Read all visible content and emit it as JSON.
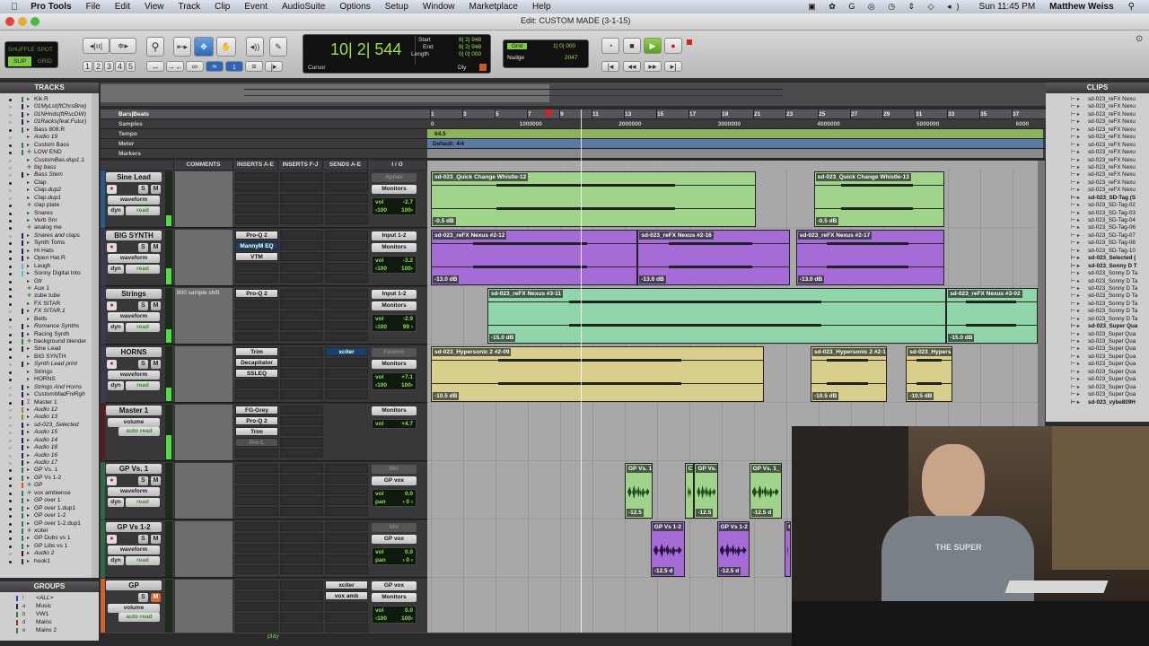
{
  "menubar": {
    "app": "Pro Tools",
    "items": [
      "File",
      "Edit",
      "View",
      "Track",
      "Clip",
      "Event",
      "AudioSuite",
      "Options",
      "Setup",
      "Window",
      "Marketplace",
      "Help"
    ],
    "clock": "Sun 11:45 PM",
    "user": "Matthew Weiss"
  },
  "window": {
    "title": "Edit: CUSTOM MADE (3-1-15)"
  },
  "toolbar": {
    "modes": [
      "SHUFFLE",
      "SPOT",
      "SLIP",
      "GRID"
    ],
    "active_mode": "SLIP",
    "zoom_presets": [
      "1",
      "2",
      "3",
      "4",
      "5"
    ],
    "counter": {
      "main": "10| 2| 544",
      "start_label": "Start",
      "end_label": "End",
      "length_label": "Length",
      "start": "8| 2| 948",
      "end": "8| 2| 948",
      "length": "0| 0| 000",
      "cursor_label": "Cursor",
      "dly_label": "Dly"
    },
    "grid": {
      "label": "Grid",
      "value": "1| 0| 000",
      "nudge_label": "Nudge",
      "nudge_value": "2047"
    }
  },
  "tracks_panel": {
    "title": "TRACKS",
    "items": [
      {
        "name": "Kik.R",
        "active": true,
        "color": "#2e7d4f"
      },
      {
        "name": "01MyLst(ftChrsBrw)",
        "active": false,
        "italic": true,
        "color": "#1c2a4a"
      },
      {
        "name": "01NHnds(ftRscDW)",
        "active": false,
        "italic": true,
        "color": "#1c2a4a"
      },
      {
        "name": "01Racks(feat.Futur)",
        "active": false,
        "italic": true,
        "color": "#1c2a4a"
      },
      {
        "name": "Bass 808.R",
        "active": true,
        "color": "#2e7d4f"
      },
      {
        "name": "Audio 19",
        "active": false,
        "italic": true,
        "color": ""
      },
      {
        "name": "Custom Bass",
        "active": true,
        "color": "#2e7d4f"
      },
      {
        "name": "LOW END",
        "active": true,
        "color": "#2e7d4f",
        "aux": true
      },
      {
        "name": "CustomBas.dup1.1",
        "active": false,
        "italic": true,
        "color": ""
      },
      {
        "name": "big bass",
        "active": false,
        "italic": true,
        "color": "",
        "aux": true
      },
      {
        "name": "Bass Stem",
        "active": false,
        "italic": true,
        "color": "#3a1418"
      },
      {
        "name": "Clap",
        "active": true,
        "color": ""
      },
      {
        "name": "Clap.dup2",
        "active": false,
        "italic": true,
        "color": ""
      },
      {
        "name": "Clap.dup1",
        "active": false,
        "italic": true,
        "color": ""
      },
      {
        "name": "clap plate",
        "active": true,
        "color": "",
        "aux": true
      },
      {
        "name": "Snares",
        "active": true,
        "color": ""
      },
      {
        "name": "Verb Snr",
        "active": true,
        "color": ""
      },
      {
        "name": "analog me",
        "active": true,
        "color": "",
        "aux": true
      },
      {
        "name": "Snares and claps",
        "active": false,
        "italic": true,
        "color": "#1c2a4a"
      },
      {
        "name": "Synth Toms",
        "active": true,
        "color": "#1c2a4a"
      },
      {
        "name": "Hi Hats",
        "active": true,
        "color": "#1c2a4a"
      },
      {
        "name": "Open Hat.R",
        "active": true,
        "color": "#1c2a4a"
      },
      {
        "name": "Laugh",
        "active": true,
        "color": "#5ab8e0"
      },
      {
        "name": "Sonny Digital Into",
        "active": true,
        "color": "#5ab8e0"
      },
      {
        "name": "Gtr",
        "active": true,
        "color": ""
      },
      {
        "name": "Aux 1",
        "active": true,
        "color": "",
        "aux": true
      },
      {
        "name": "zube tube",
        "active": true,
        "color": "",
        "aux": true
      },
      {
        "name": "FX SITAR",
        "active": true,
        "color": ""
      },
      {
        "name": "FX SITAR.1",
        "active": false,
        "italic": true,
        "color": "#1c2a4a"
      },
      {
        "name": "Bells",
        "active": true,
        "color": ""
      },
      {
        "name": "Romance Synths",
        "active": false,
        "italic": true,
        "color": "#1c2a4a"
      },
      {
        "name": "Racing Synth",
        "active": true,
        "color": "#1c2a4a"
      },
      {
        "name": "background blender",
        "active": true,
        "color": "#2e7d4f",
        "aux": true
      },
      {
        "name": "Sine Lead",
        "active": true,
        "color": "#1c2a4a"
      },
      {
        "name": "BIG SYNTH",
        "active": true,
        "color": ""
      },
      {
        "name": "Synth Lead print",
        "active": false,
        "italic": true,
        "color": "#1c2a4a"
      },
      {
        "name": "Strings",
        "active": true,
        "color": ""
      },
      {
        "name": "HORNS",
        "active": true,
        "color": ""
      },
      {
        "name": "Strings And Horns",
        "active": false,
        "italic": true,
        "color": "#1c2a4a"
      },
      {
        "name": "CustomMadFnlRgh",
        "active": false,
        "italic": true,
        "color": "#1c2a4a"
      },
      {
        "name": "Master 1",
        "active": true,
        "color": "#3a1418",
        "master": true
      },
      {
        "name": "Audio 12",
        "active": false,
        "italic": true,
        "color": "#8a8a2a"
      },
      {
        "name": "Audio 13",
        "active": false,
        "italic": true,
        "color": "#8a8a2a"
      },
      {
        "name": "sd-023_Selected",
        "active": false,
        "italic": true,
        "color": "#1c2a4a"
      },
      {
        "name": "Audio 15",
        "active": false,
        "italic": true,
        "color": "#1c2a4a"
      },
      {
        "name": "Audio 14",
        "active": false,
        "italic": true,
        "color": "#1c2a4a"
      },
      {
        "name": "Audio 18",
        "active": false,
        "italic": true,
        "color": "#1c2a4a"
      },
      {
        "name": "Audio 16",
        "active": false,
        "italic": true,
        "color": "#1c2a4a"
      },
      {
        "name": "Audio 17",
        "active": false,
        "italic": true,
        "color": "#1c2a4a"
      },
      {
        "name": "GP Vs. 1",
        "active": true,
        "color": "#2e7d4f"
      },
      {
        "name": "GP Vs 1-2",
        "active": true,
        "color": "#2e7d4f"
      },
      {
        "name": "GP",
        "active": true,
        "color": "#d0522a",
        "aux": true
      },
      {
        "name": "vox ambience",
        "active": true,
        "color": "#2e7d4f",
        "aux": true
      },
      {
        "name": "GP over 1",
        "active": true,
        "color": "#2e7d4f"
      },
      {
        "name": "GP over 1.dup1",
        "active": true,
        "color": "#2e7d4f"
      },
      {
        "name": "GP over 1-2",
        "active": true,
        "color": "#2e7d4f"
      },
      {
        "name": "GP over 1-2.dup1",
        "active": true,
        "color": "#2e7d4f"
      },
      {
        "name": "xciter",
        "active": true,
        "color": "#2e7d4f",
        "aux": true
      },
      {
        "name": "GP Dubs vs 1",
        "active": true,
        "color": "#2e7d4f"
      },
      {
        "name": "GP Libs vs 1",
        "active": true,
        "color": "#2e7d4f"
      },
      {
        "name": "Audio 2",
        "active": false,
        "italic": true,
        "color": "#3a1418"
      },
      {
        "name": "hook1",
        "active": true,
        "color": "#1c2a4a"
      }
    ]
  },
  "groups_panel": {
    "title": "GROUPS",
    "items": [
      {
        "id": "!",
        "name": "<ALL>",
        "color": "#2244cc"
      },
      {
        "id": "a",
        "name": "Music",
        "color": "#1c2a4a"
      },
      {
        "id": "b",
        "name": "VW1",
        "color": "#2e7d4f"
      },
      {
        "id": "d",
        "name": "Mains",
        "color": "#a02828"
      },
      {
        "id": "e",
        "name": "Mains 2",
        "color": "#2e7d4f"
      }
    ]
  },
  "clips_panel": {
    "title": "CLIPS",
    "items": [
      {
        "name": "sd-023_reFX Nexu"
      },
      {
        "name": "sd-023_reFX Nexu"
      },
      {
        "name": "sd-023_reFX Nexu"
      },
      {
        "name": "sd-023_reFX Nexu"
      },
      {
        "name": "sd-023_reFX Nexu"
      },
      {
        "name": "sd-023_reFX Nexu"
      },
      {
        "name": "sd-023_reFX Nexu"
      },
      {
        "name": "sd-023_reFX Nexu"
      },
      {
        "name": "sd-023_reFX Nexu"
      },
      {
        "name": "sd-023_reFX Nexu"
      },
      {
        "name": "sd-023_reFX Nexu"
      },
      {
        "name": "sd-023_reFX Nexu"
      },
      {
        "name": "sd-023_reFX Nexu"
      },
      {
        "name": "sd-023_SD-Tag (S",
        "bold": true
      },
      {
        "name": "sd-023_SD-Tag-02"
      },
      {
        "name": "sd-023_SD-Tag-03"
      },
      {
        "name": "sd-023_SD-Tag-04"
      },
      {
        "name": "sd-023_SD-Tag-06"
      },
      {
        "name": "sd-023_SD-Tag-07"
      },
      {
        "name": "sd-023_SD-Tag-08"
      },
      {
        "name": "sd-023_SD-Tag-10"
      },
      {
        "name": "sd-023_Selected (",
        "bold": true
      },
      {
        "name": "sd-023_Sonny D T",
        "bold": true
      },
      {
        "name": "sd-023_Sonny D Ta"
      },
      {
        "name": "sd-023_Sonny D Ta"
      },
      {
        "name": "sd-023_Sonny D Ta"
      },
      {
        "name": "sd-023_Sonny D Ta"
      },
      {
        "name": "sd-023_Sonny D Ta"
      },
      {
        "name": "sd-023_Sonny D Ta"
      },
      {
        "name": "sd-023_Sonny D Ta"
      },
      {
        "name": "sd-023_Super Qua",
        "bold": true
      },
      {
        "name": "sd-023_Super Qua"
      },
      {
        "name": "sd-023_Super Qua"
      },
      {
        "name": "sd-023_Super Qua"
      },
      {
        "name": "sd-023_Super Qua"
      },
      {
        "name": "sd-023_Super Qua"
      },
      {
        "name": "sd-023_Super Qua"
      },
      {
        "name": "sd-023_Super Qua"
      },
      {
        "name": "sd-023_Super Qua"
      },
      {
        "name": "sd-023_Super Qua"
      },
      {
        "name": "sd-023_vybe809H",
        "bold": true
      }
    ]
  },
  "edit": {
    "rulers": {
      "bars_label": "Bars|Beats",
      "samples_label": "Samples",
      "tempo_label": "Tempo",
      "meter_label": "Meter",
      "markers_label": "Markers",
      "bar_ticks": [
        "1",
        "3",
        "5",
        "7",
        "9",
        "11",
        "13",
        "15",
        "17",
        "19",
        "21",
        "23",
        "25",
        "27",
        "29",
        "31",
        "33",
        "35",
        "37"
      ],
      "sample_ticks": [
        "0",
        "1000000",
        "2000000",
        "3000000",
        "4000000",
        "5000000",
        "6000"
      ],
      "tempo_value": "64.5",
      "meter_value": "Default: 4/4"
    },
    "columns": {
      "comments": "COMMENTS",
      "inserts_ae": "INSERTS A-E",
      "inserts_fj": "INSERTS F-J",
      "sends": "SENDS A-E",
      "io": "I / O"
    },
    "playhead_bar": 10.3,
    "selection_bar": 8.3,
    "tracks": [
      {
        "name": "Sine Lead",
        "color": "#2b5a8a",
        "view": "waveform",
        "dyn": "dyn",
        "auto": "read",
        "comment": "",
        "ins_ae": [],
        "ins_fj": [],
        "sends": [],
        "input": "Aphex",
        "input_dim": true,
        "output": "Monitors",
        "vol": "-2.7",
        "pan_l": "‹100",
        "pan_r": "100›",
        "meter": 0.2,
        "clips": [
          {
            "name": "sd-023_Quick Change Whistle-12",
            "gain": "-0.5 dB",
            "start": 1,
            "end": 21.1
          },
          {
            "name": "sd-023_Quick Change Whistle-13",
            "gain": "-0.5 dB",
            "start": 24.7,
            "end": 32.8
          }
        ],
        "clip_color": "#9fd48a"
      },
      {
        "name": "BIG SYNTH",
        "color": "#3a3a50",
        "view": "waveform",
        "dyn": "dyn",
        "auto": "read",
        "comment": "",
        "ins_ae": [
          {
            "n": "Pro-Q 2"
          },
          {
            "n": "MannyM EQ",
            "sel": true
          },
          {
            "n": "VTM"
          }
        ],
        "ins_fj": [],
        "sends": [],
        "input": "Input 1-2",
        "output": "Monitors",
        "vol": "-3.2",
        "pan_l": "‹100",
        "pan_r": "100›",
        "meter": 0.3,
        "clips": [
          {
            "name": "sd-023_reFX Nexus #2-12",
            "gain": "-13.0 dB",
            "start": 1,
            "end": 13.8
          },
          {
            "name": "sd-023_reFX Nexus #2-16",
            "gain": "-13.0 dB",
            "start": 13.8,
            "end": 23.2
          },
          {
            "name": "sd-023_reFX Nexus #2-17",
            "gain": "-13.0 dB",
            "start": 23.6,
            "end": 32.8
          }
        ],
        "clip_color": "#a56cd8"
      },
      {
        "name": "Strings",
        "color": "#3a3a50",
        "view": "waveform",
        "dyn": "dyn",
        "auto": "read",
        "comment": "800 sample shift",
        "ins_ae": [
          {
            "n": "Pro-Q 2"
          }
        ],
        "ins_fj": [],
        "sends": [],
        "input": "Input 1-2",
        "output": "Monitors",
        "vol": "-2.9",
        "pan_l": "‹100",
        "pan_r": "99 ›",
        "meter": 0.25,
        "clips": [
          {
            "name": "sd-023_reFX Nexus #3-11",
            "gain": "-15.0 dB",
            "start": 4.5,
            "end": 32.9
          },
          {
            "name": "sd-023_reFX Nexus #3-02",
            "gain": "-15.0 dB",
            "start": 32.9,
            "end": 38.6
          }
        ],
        "clip_color": "#90d6aa"
      },
      {
        "name": "HORNS",
        "color": "#3a3a50",
        "view": "waveform",
        "dyn": "dyn",
        "auto": "read",
        "comment": "",
        "ins_ae": [
          {
            "n": "Trim"
          },
          {
            "n": "Decapitator"
          },
          {
            "n": "SSLEQ"
          }
        ],
        "ins_fj": [],
        "sends": [
          {
            "n": "xciter",
            "sel": true
          }
        ],
        "input": "Fantom",
        "input_dim": true,
        "output": "Monitors",
        "vol": "+7.1",
        "pan_l": "‹100",
        "pan_r": "100›",
        "meter": 0.25,
        "clips": [
          {
            "name": "sd-023_Hypersonic 2 #2-09",
            "gain": "-10.5 dB",
            "start": 1,
            "end": 21.6
          },
          {
            "name": "sd-023_Hypersonic 2 #2-1",
            "gain": "-10.5 dB",
            "start": 24.5,
            "end": 29.2
          },
          {
            "name": "sd-023_Hypers",
            "gain": "-10.5 dB",
            "start": 30.4,
            "end": 33.3
          }
        ],
        "clip_color": "#d8cf8c"
      },
      {
        "name": "Master 1",
        "color": "#5a1a22",
        "master": true,
        "view": "volume",
        "auto": "auto read",
        "comment": "",
        "ins_ae": [],
        "ins_fj": [],
        "ins_ae_master": [
          {
            "n": "FG-Grey"
          },
          {
            "n": "Pro-Q 2"
          },
          {
            "n": "Trim"
          },
          {
            "n": "Pro-L",
            "dim": true
          }
        ],
        "sends": [],
        "output": "Monitors",
        "vol": "+4.7",
        "meter": 0.45,
        "clips": [],
        "clip_color": ""
      },
      {
        "name": "GP Vs. 1",
        "color": "#2e6a44",
        "view": "waveform",
        "dyn": "dyn",
        "auto": "read",
        "comment": "",
        "ins_ae": [],
        "ins_fj": [],
        "sends": [],
        "input": "Mic",
        "input_dim": true,
        "output": "GP vox",
        "vol": "0.0",
        "pan_label": "pan",
        "pan_val": "› 0 ‹",
        "meter": 0,
        "clips": [
          {
            "name": "GP Vs. 1",
            "gain": "-12.5",
            "start": 13,
            "end": 14.7
          },
          {
            "name": "C",
            "gain": "",
            "start": 16.7,
            "end": 17.3
          },
          {
            "name": "GP Vs.",
            "gain": "-12.5",
            "start": 17.3,
            "end": 18.8
          },
          {
            "name": "GP Vs. 1_",
            "gain": "-12.5 d",
            "start": 20.7,
            "end": 22.7
          }
        ],
        "clip_color": "#9fd48a",
        "wave": "#1f4a1f"
      },
      {
        "name": "GP Vs 1-2",
        "color": "#2e6a44",
        "view": "waveform",
        "dyn": "dyn",
        "auto": "read",
        "comment": "",
        "ins_ae": [],
        "ins_fj": [],
        "sends": [],
        "input": "Mic",
        "input_dim": true,
        "output": "GP vox",
        "vol": "0.0",
        "pan_label": "pan",
        "pan_val": "› 0 ‹",
        "meter": 0,
        "clips": [
          {
            "name": "GP Vs 1-2",
            "gain": "-12.5 d",
            "start": 14.6,
            "end": 16.7
          },
          {
            "name": "GP Vs 1-2",
            "gain": "-12.5 d",
            "start": 18.7,
            "end": 20.7
          },
          {
            "name": "G",
            "gain": "",
            "start": 22.9,
            "end": 23.3
          }
        ],
        "clip_color": "#a56cd8",
        "wave": "#2a1240"
      },
      {
        "name": "GP",
        "color": "#d0602a",
        "aux": true,
        "view": "volume",
        "auto": "auto read",
        "comment": "",
        "ins_ae": [],
        "ins_fj": [],
        "sends": [
          {
            "n": "xciter"
          },
          {
            "n": "vox amb"
          }
        ],
        "input": "GP vox",
        "output": "Monitors",
        "vol": "0.0",
        "pan_l": "‹100",
        "pan_r": "100›",
        "meter": 0,
        "clips": [],
        "clip_color": ""
      }
    ],
    "vol_label": "vol",
    "status_text": "play"
  },
  "webcam": {
    "shirt_text": "THE SUPER"
  }
}
